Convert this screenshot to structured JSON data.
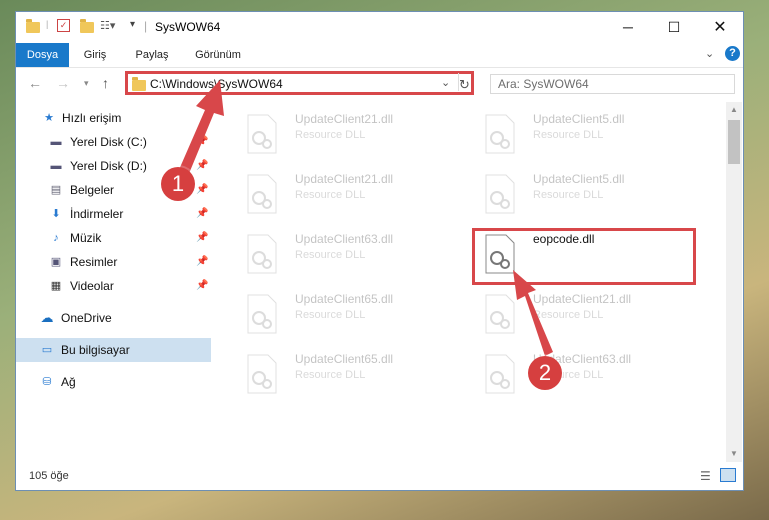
{
  "window": {
    "title": "SysWOW64"
  },
  "ribbon": {
    "tabs": [
      {
        "label": "Dosya",
        "active": true
      },
      {
        "label": "Giriş"
      },
      {
        "label": "Paylaş"
      },
      {
        "label": "Görünüm"
      }
    ]
  },
  "address": {
    "path": "C:\\Windows\\SysWOW64",
    "search_placeholder": "Ara: SysWOW64"
  },
  "sidebar": {
    "items": [
      {
        "label": "Hızlı erişim",
        "icon": "star-icon"
      },
      {
        "label": "Yerel Disk (C:)",
        "icon": "drive-icon",
        "pinned": true
      },
      {
        "label": "Yerel Disk (D:)",
        "icon": "drive-icon",
        "pinned": true
      },
      {
        "label": "Belgeler",
        "icon": "documents-icon",
        "pinned": true
      },
      {
        "label": "İndirmeler",
        "icon": "download-icon",
        "pinned": true
      },
      {
        "label": "Müzik",
        "icon": "music-icon",
        "pinned": true
      },
      {
        "label": "Resimler",
        "icon": "pictures-icon",
        "pinned": true
      },
      {
        "label": "Videolar",
        "icon": "videos-icon",
        "pinned": true
      },
      {
        "label": "OneDrive",
        "icon": "cloud-icon"
      },
      {
        "label": "Bu bilgisayar",
        "icon": "computer-icon",
        "selected": true
      },
      {
        "label": "Ağ",
        "icon": "network-icon"
      }
    ]
  },
  "files": [
    {
      "name": "UpdateClient21.dll",
      "type": "Resource DLL"
    },
    {
      "name": "UpdateClient5.dll",
      "type": "Resource DLL"
    },
    {
      "name": "UpdateClient21.dll",
      "type": "Resource DLL"
    },
    {
      "name": "UpdateClient5.dll",
      "type": "Resource DLL"
    },
    {
      "name": "UpdateClient63.dll",
      "type": "Resource DLL"
    },
    {
      "name": "eopcode.dll",
      "type": ""
    },
    {
      "name": "UpdateClient65.dll",
      "type": "Resource DLL"
    },
    {
      "name": "UpdateClient21.dll",
      "type": "Resource DLL"
    },
    {
      "name": "UpdateClient65.dll",
      "type": "Resource DLL"
    },
    {
      "name": "UpdateClient63.dll",
      "type": "Resource DLL"
    }
  ],
  "status": {
    "count": "105 öğe"
  },
  "annotations": {
    "badge1": "1",
    "badge2": "2",
    "accent": "#d8474a"
  }
}
